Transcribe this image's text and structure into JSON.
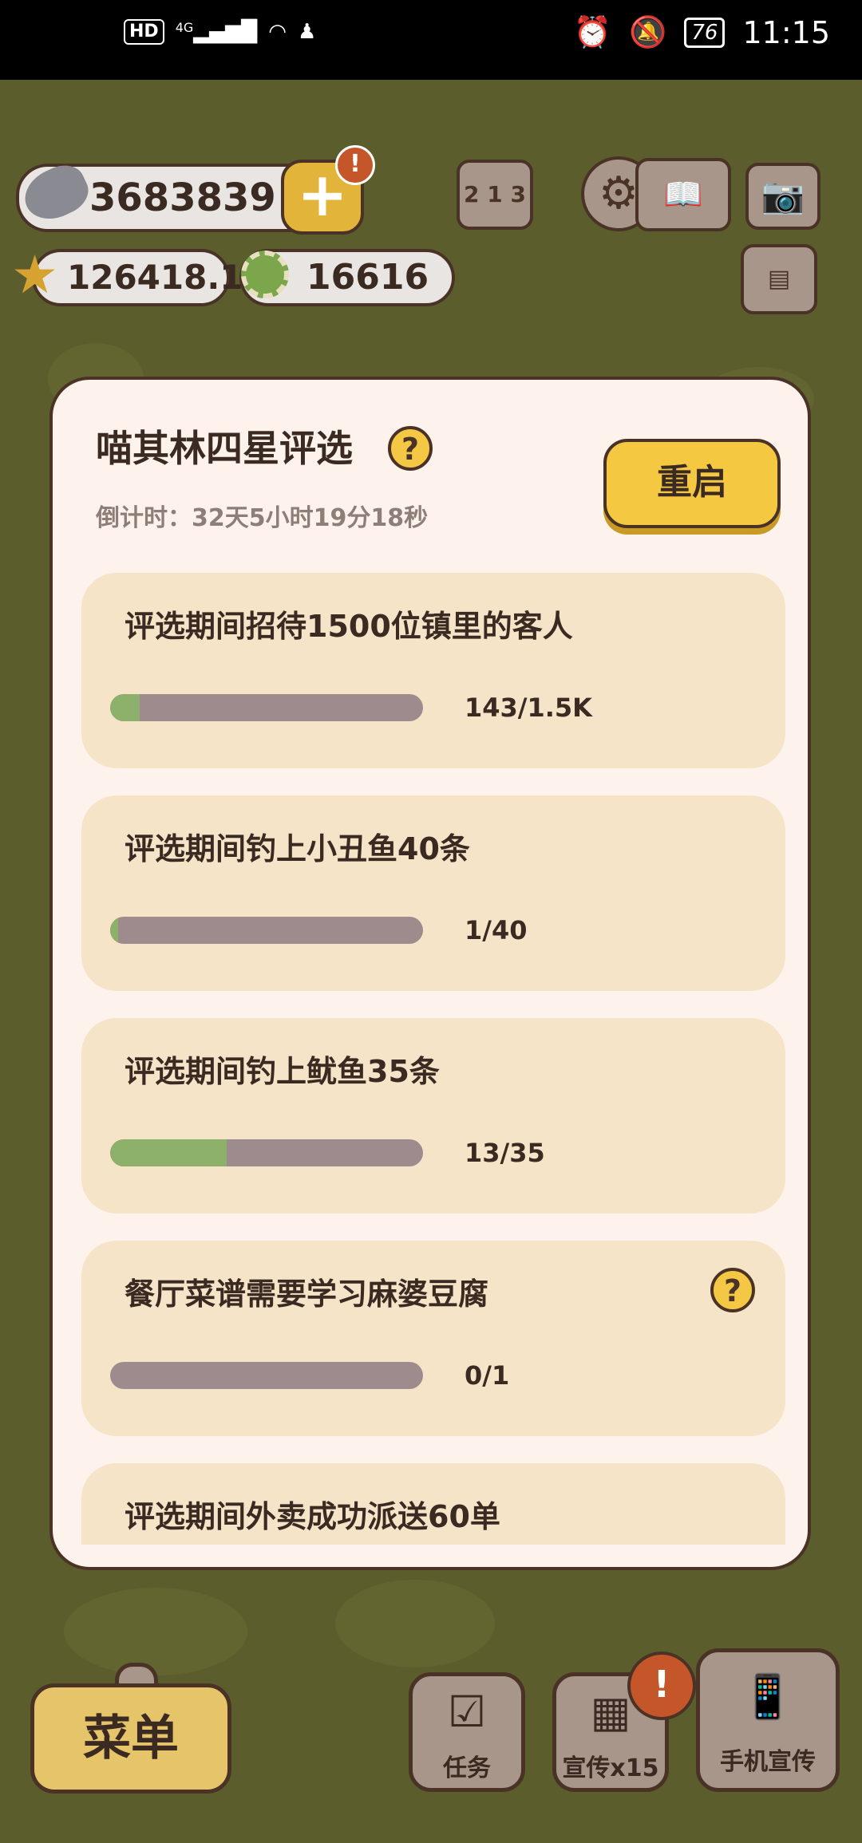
{
  "status_bar": {
    "network": "HD",
    "signal": "4G",
    "battery": "76",
    "time": "11:15"
  },
  "currencies": {
    "fish": "3683839",
    "stars": "126418.1",
    "coins": "16616"
  },
  "modal": {
    "title": "喵其林四星评选",
    "countdown": "倒计时：32天5小时19分18秒",
    "restart_label": "重启",
    "tasks": [
      {
        "title": "评选期间招待1500位镇里的客人",
        "progress_text": "143/1.5K",
        "progress": 0.0953,
        "has_help": false
      },
      {
        "title": "评选期间钓上小丑鱼40条",
        "progress_text": "1/40",
        "progress": 0.025,
        "has_help": false
      },
      {
        "title": "评选期间钓上鱿鱼35条",
        "progress_text": "13/35",
        "progress": 0.3714,
        "has_help": false
      },
      {
        "title": "餐厅菜谱需要学习麻婆豆腐",
        "progress_text": "0/1",
        "progress": 0,
        "has_help": true
      },
      {
        "title": "评选期间外卖成功派送60单",
        "progress_text": "",
        "progress": 0,
        "has_help": false
      }
    ]
  },
  "bottom_bar": {
    "menu_label": "菜单",
    "task_label": "任务",
    "promo_label": "宣传x15",
    "phone_promo_label": "手机宣传"
  },
  "icons": {
    "help": "?",
    "plus": "+",
    "alert": "!"
  },
  "colors": {
    "progress_fill": "#8db06a",
    "progress_track": "#9d8b8d",
    "accent_button": "#f5c842",
    "alert_badge": "#c4562a"
  }
}
